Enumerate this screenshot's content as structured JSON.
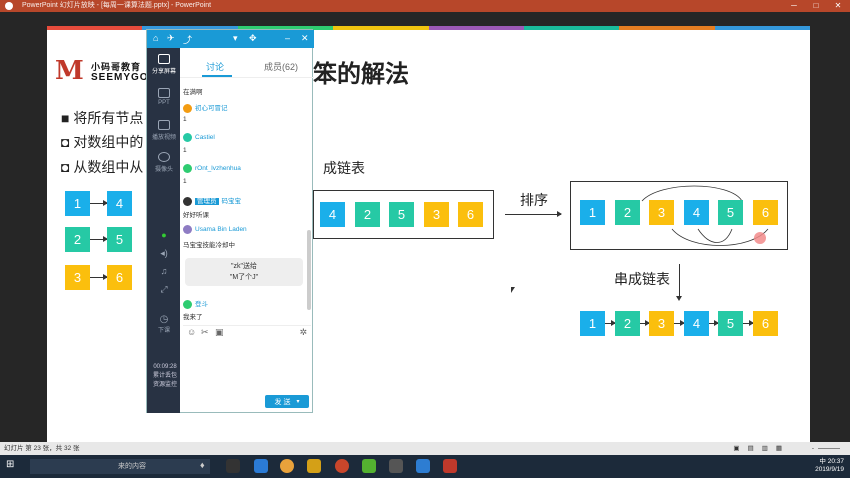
{
  "window": {
    "title": "PowerPoint 幻灯片放映 - [每周一课算法题.pptx] - PowerPoint",
    "controls": [
      "─",
      "□",
      "✕"
    ]
  },
  "slide": {
    "title": "笨的解法",
    "logo": {
      "mark": "M",
      "line1": "小码哥教育",
      "line2": "SEEMYGO"
    },
    "bullets": [
      "■ 将所有节点",
      "◘ 对数组中的",
      "◘ 从数组中从"
    ],
    "bullet_tail": "成链表",
    "accent_colors": [
      "#1aafea",
      "#26c9a5",
      "#fbbf0d",
      "#e74c3c",
      "#2ecc71",
      "#3498db"
    ],
    "pairs": [
      {
        "a": "1",
        "b": "4"
      },
      {
        "a": "2",
        "b": "5"
      },
      {
        "a": "3",
        "b": "6"
      }
    ],
    "unsorted": [
      "4",
      "2",
      "5",
      "3",
      "6"
    ],
    "sort_label": "排序",
    "sorted": [
      "1",
      "2",
      "3",
      "4",
      "5",
      "6"
    ],
    "link_label": "串成链表",
    "linked": [
      "1",
      "2",
      "3",
      "4",
      "5",
      "6"
    ]
  },
  "chat": {
    "header_icons": [
      "home-icon",
      "send-icon",
      "share-icon",
      "pin-icon",
      "minimize-icon",
      "close-icon"
    ],
    "sidebar": [
      {
        "label": "分享屏幕",
        "icon": "screen-share-icon"
      },
      {
        "label": "PPT",
        "icon": "ppt-icon"
      },
      {
        "label": "播放视频",
        "icon": "video-icon"
      },
      {
        "label": "摄像头",
        "icon": "camera-icon"
      }
    ],
    "tabs": {
      "discuss": "讨论",
      "members": "成员(62)"
    },
    "messages": [
      {
        "name": "",
        "text": "在满啊"
      },
      {
        "name": "初心可冒记",
        "text": "1"
      },
      {
        "name": "Castiel",
        "text": "1"
      },
      {
        "name": "rOnt_lvzhenhua",
        "text": "1"
      },
      {
        "name": "码宝宝",
        "badge": "管理员",
        "text": "好好听课"
      },
      {
        "name": "Usama Bin Laden",
        "text": "马宝宝技能冷却中"
      },
      {
        "name": "登斗",
        "text": "我来了"
      }
    ],
    "gift": {
      "line1": "\"zk\"送给",
      "line2": "\"M了个J\""
    },
    "send_label": "发 送",
    "timer": "00:09:28",
    "side_bottom": [
      "下课",
      "累计丢包",
      "资源监控"
    ]
  },
  "status_bar": {
    "left": "幻灯片 第 23 张，共 32 张",
    "right": "-"
  },
  "taskbar": {
    "search": "来的内容",
    "time": "20:37",
    "date": "2019/9/19",
    "ime": "中"
  }
}
